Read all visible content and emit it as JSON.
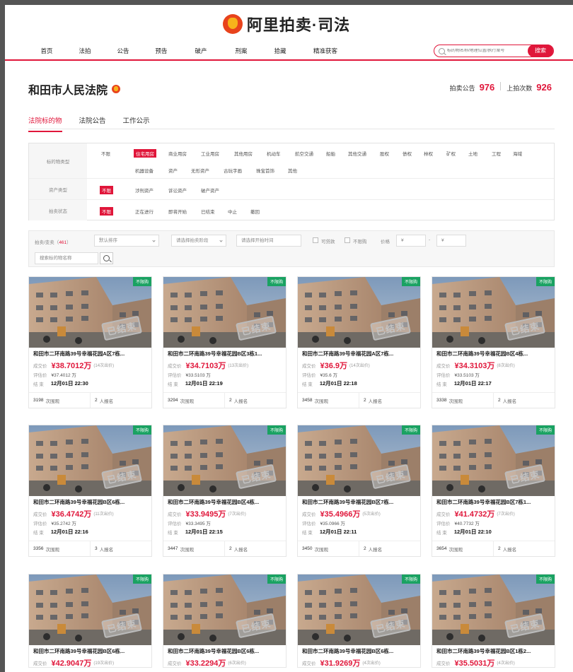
{
  "header": {
    "logo_text": "阿里拍卖·司法",
    "nav": [
      "首页",
      "法拍",
      "公告",
      "预告",
      "破产",
      "刑案",
      "拾藏",
      "精准获客"
    ],
    "search_placeholder": "标的物名称/地理位置/执行案号",
    "search_button": "搜索"
  },
  "court": {
    "name": "和田市人民法院",
    "notice_label": "拍卖公告",
    "notice_count": "976",
    "auction_label": "上拍次数",
    "auction_count": "926"
  },
  "tabs": [
    "法院标的物",
    "法院公告",
    "工作公示"
  ],
  "filters": {
    "type_label": "标的物类型",
    "type_items_row1": [
      "不限",
      "住宅用房",
      "商业用房",
      "工业用房",
      "其他用房",
      "机动车",
      "航空交通",
      "船舶",
      "其他交通",
      "股权",
      "债权",
      "林权",
      "矿权",
      "土地",
      "工程",
      "海域"
    ],
    "type_items_row2": [
      "机器设备",
      "资产",
      "无形资产",
      "古玩字画",
      "珠宝首饰",
      "其他"
    ],
    "asset_label": "资产类型",
    "asset_items": [
      "不限",
      "涉刑资产",
      "诉讼资产",
      "破产资产"
    ],
    "status_label": "拍卖状态",
    "status_items": [
      "不限",
      "正在进行",
      "即将开始",
      "已结束",
      "中止",
      "撤回"
    ]
  },
  "search_bar": {
    "result_prefix": "拍卖/变卖（",
    "result_count": "461",
    "result_suffix": "）",
    "sort_select": "默认排序",
    "stage_select": "请选择拍卖阶段",
    "time_select": "请选择开拍时间",
    "check_loan": "可贷款",
    "check_limit": "不限购",
    "price_label": "价格",
    "price_min": "¥",
    "price_dash": "-",
    "price_max": "¥",
    "name_placeholder": "搜索标的物名称"
  },
  "card_labels": {
    "deal_label": "成交价",
    "eval_label": "评估价",
    "end_label": "结 束",
    "tag": "不限购",
    "stamp": "已结束",
    "views_suffix": "次围观",
    "signup_suffix": "人报名"
  },
  "listings": [
    {
      "title": "和田市二环南路39号幸福花园A区7栋...",
      "price": "¥38.7012万",
      "bids": "(14次出价)",
      "eval": "¥37.4012 万",
      "end": "12月01日 22:30",
      "views": "3198",
      "signups": "2"
    },
    {
      "title": "和田市二环南路39号幸福花园B区3栋1...",
      "price": "¥34.7103万",
      "bids": "(13次出价)",
      "eval": "¥33.5103 万",
      "end": "12月01日 22:19",
      "views": "3294",
      "signups": "2"
    },
    {
      "title": "和田市二环南路39号幸福花园A区7栋...",
      "price": "¥36.9万",
      "bids": "(14次出价)",
      "eval": "¥35.6 万",
      "end": "12月01日 22:18",
      "views": "3458",
      "signups": "2"
    },
    {
      "title": "和田市二环南路39号幸福花园B区4栋...",
      "price": "¥34.3103万",
      "bids": "(8次出价)",
      "eval": "¥33.5103 万",
      "end": "12月01日 22:17",
      "views": "3338",
      "signups": "2"
    },
    {
      "title": "和田市二环南路39号幸福花园B区6栋...",
      "price": "¥36.4742万",
      "bids": "(11次出价)",
      "eval": "¥35.2742 万",
      "end": "12月01日 22:16",
      "views": "3356",
      "signups": "3"
    },
    {
      "title": "和田市二环南路39号幸福花园B区4栋...",
      "price": "¥33.9495万",
      "bids": "(7次出价)",
      "eval": "¥33.3495 万",
      "end": "12月01日 22:15",
      "views": "3447",
      "signups": "2"
    },
    {
      "title": "和田市二环南路39号幸福花园B区7栋...",
      "price": "¥35.4966万",
      "bids": "(5次出价)",
      "eval": "¥35.0966 万",
      "end": "12月01日 22:11",
      "views": "3450",
      "signups": "2"
    },
    {
      "title": "和田市二环南路39号幸福花园B区7栋1...",
      "price": "¥41.4732万",
      "bids": "(7次出价)",
      "eval": "¥40.7732 万",
      "end": "12月01日 22:10",
      "views": "3654",
      "signups": "2"
    },
    {
      "title": "和田市二环南路39号幸福花园B区6栋...",
      "price": "¥42.9047万",
      "bids": "(19次出价)",
      "eval": "",
      "end": "",
      "views": "",
      "signups": ""
    },
    {
      "title": "和田市二环南路39号幸福花园B区6栋...",
      "price": "¥33.2294万",
      "bids": "(6次出价)",
      "eval": "",
      "end": "",
      "views": "",
      "signups": ""
    },
    {
      "title": "和田市二环南路39号幸福花园B区6栋...",
      "price": "¥31.9269万",
      "bids": "(4次出价)",
      "eval": "",
      "end": "",
      "views": "",
      "signups": ""
    },
    {
      "title": "和田市二环南路39号幸福花园B区1栋2...",
      "price": "¥35.5031万",
      "bids": "(4次出价)",
      "eval": "",
      "end": "",
      "views": "",
      "signups": ""
    }
  ]
}
